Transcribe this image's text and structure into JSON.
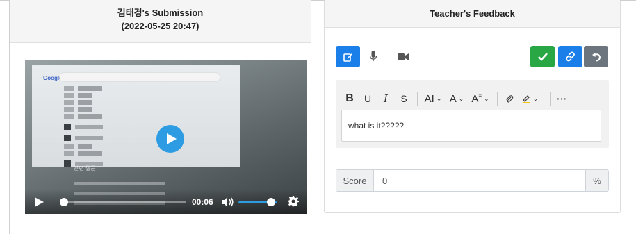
{
  "submission": {
    "title": "김태경's Submission",
    "timestamp": "(2022-05-25 20:47)",
    "video": {
      "current_time": "00:06",
      "progress": 0.02,
      "volume": 0.85,
      "screen_logo": "Google",
      "screen_caption": "관련 질문"
    }
  },
  "feedback": {
    "title": "Teacher's Feedback",
    "icons": [
      "edit-icon",
      "microphone-icon",
      "video-camera-icon",
      "check-icon",
      "link-icon",
      "undo-icon"
    ],
    "toolbar": {
      "bold": "B",
      "underline": "U",
      "italic": "I",
      "strike": "S",
      "font_size": "AI",
      "font_color": "A",
      "more": "⋯"
    },
    "editor_text": "what is it?????",
    "score_label": "Score",
    "score_value": "0",
    "score_unit": "%"
  },
  "colors": {
    "primary": "#1a7fe8",
    "success": "#29a745",
    "secondary": "#6c757d",
    "player_accent": "#2e9ce3"
  }
}
